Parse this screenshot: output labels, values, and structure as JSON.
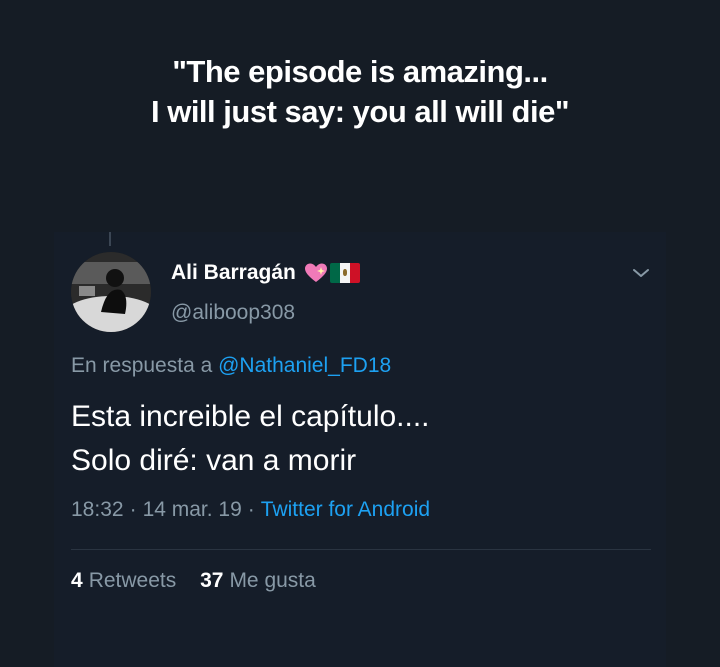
{
  "caption": {
    "line1": "\"The episode is amazing...",
    "line2": "I will just say: you all will die\""
  },
  "tweet": {
    "author": {
      "display_name": "Ali Barragán",
      "handle": "@aliboop308",
      "emoji": [
        "sparkling-heart-icon",
        "mexico-flag-icon"
      ]
    },
    "reply_prefix": "En respuesta a",
    "reply_to": "@Nathaniel_FD18",
    "text_line1": "Esta increible el capítulo....",
    "text_line2": "Solo diré: van a morir",
    "time": "18:32",
    "date": "14 mar. 19",
    "separator": "·",
    "client": "Twitter for Android",
    "retweets": {
      "count": "4",
      "label": "Retweets"
    },
    "likes": {
      "count": "37",
      "label": "Me gusta"
    }
  },
  "colors": {
    "background": "#151c25",
    "muted_text": "#8899a6",
    "link": "#1da1f2"
  }
}
